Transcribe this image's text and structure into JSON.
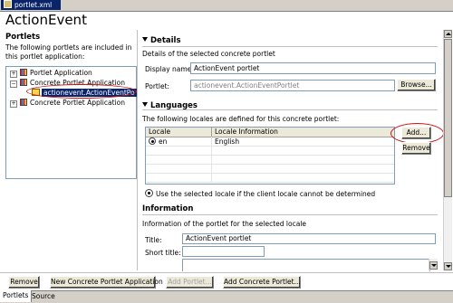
{
  "editor_tab": {
    "label": "portlet.xml"
  },
  "title": "ActionEvent",
  "portlets": {
    "heading": "Portlets",
    "description": "The following portlets are included in this portlet application:",
    "tree": [
      {
        "label": "Portlet Application"
      },
      {
        "label": "Concrete Portlet Application"
      },
      {
        "label": "actionevent.ActionEventPo"
      },
      {
        "label": "Concrete Portlet Application"
      }
    ]
  },
  "details": {
    "heading": "Details",
    "description": "Details of the selected concrete portlet",
    "display_name_label": "Display name:",
    "display_name_value": "ActionEvent portlet",
    "portlet_label": "Portlet:",
    "portlet_value": "actionevent.ActionEventPortlet",
    "browse_label": "Browse..."
  },
  "languages": {
    "heading": "Languages",
    "description": "The following locales are defined for this concrete portlet:",
    "columns": [
      "Locale",
      "Locale Information"
    ],
    "rows": [
      {
        "locale": "en",
        "info": "English"
      }
    ],
    "add_label": "Add...",
    "remove_label": "Remove",
    "fallback_text": "Use the selected locale if the client locale cannot be determined"
  },
  "information": {
    "heading": "Information",
    "description": "Information of the portlet for the selected locale",
    "title_label": "Title:",
    "title_value": "ActionEvent portlet",
    "short_title_label": "Short title:",
    "short_title_value": ""
  },
  "buttons": {
    "remove": "Remove",
    "new_concrete_app": "New Concrete Portlet Application",
    "add_portlet": "Add Portlet...",
    "add_concrete_portlet": "Add Concrete Portlet..."
  },
  "bottom_tabs": [
    "Portlets",
    "Source"
  ],
  "colors": {
    "selection": "#0a246a",
    "annotation": "#d01010"
  }
}
